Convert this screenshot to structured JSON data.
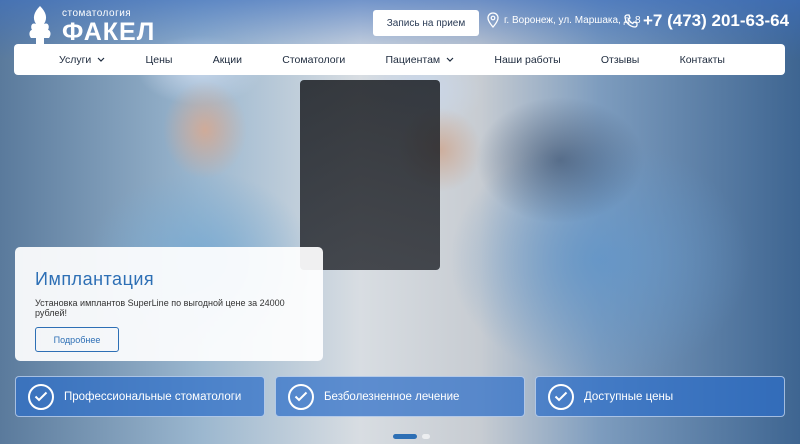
{
  "brand": {
    "subtitle": "стоматология",
    "name": "ФАКЕЛ",
    "icon": "tooth-torch-logo"
  },
  "header": {
    "appointment_label": "Запись на прием",
    "address": "г. Воронеж, ул. Маршака, д. 8",
    "address_icon": "location-pin-icon",
    "phone": "+7 (473) 201-63-64",
    "phone_icon": "phone-icon"
  },
  "nav": {
    "items": [
      {
        "label": "Услуги",
        "dropdown": true
      },
      {
        "label": "Цены",
        "dropdown": false
      },
      {
        "label": "Акции",
        "dropdown": false
      },
      {
        "label": "Стоматологи",
        "dropdown": false
      },
      {
        "label": "Пациентам",
        "dropdown": true
      },
      {
        "label": "Наши работы",
        "dropdown": false
      },
      {
        "label": "Отзывы",
        "dropdown": false
      },
      {
        "label": "Контакты",
        "dropdown": false
      }
    ]
  },
  "promo": {
    "title": "Имплантация",
    "description": "Установка имплантов SuperLine по выгодной цене за 24000 рублей!",
    "button_label": "Подробнее"
  },
  "features": [
    {
      "label": "Профессиональные стоматологи",
      "icon": "check-circle-icon"
    },
    {
      "label": "Безболезненное лечение",
      "icon": "check-circle-icon"
    },
    {
      "label": "Доступные цены",
      "icon": "check-circle-icon"
    }
  ],
  "slider": {
    "slide_count": 2,
    "active_slide": 1
  },
  "colors": {
    "accent": "#2d6fb5",
    "nav_bg": "#ffffff",
    "feature_bg": "#2d6ec8"
  }
}
